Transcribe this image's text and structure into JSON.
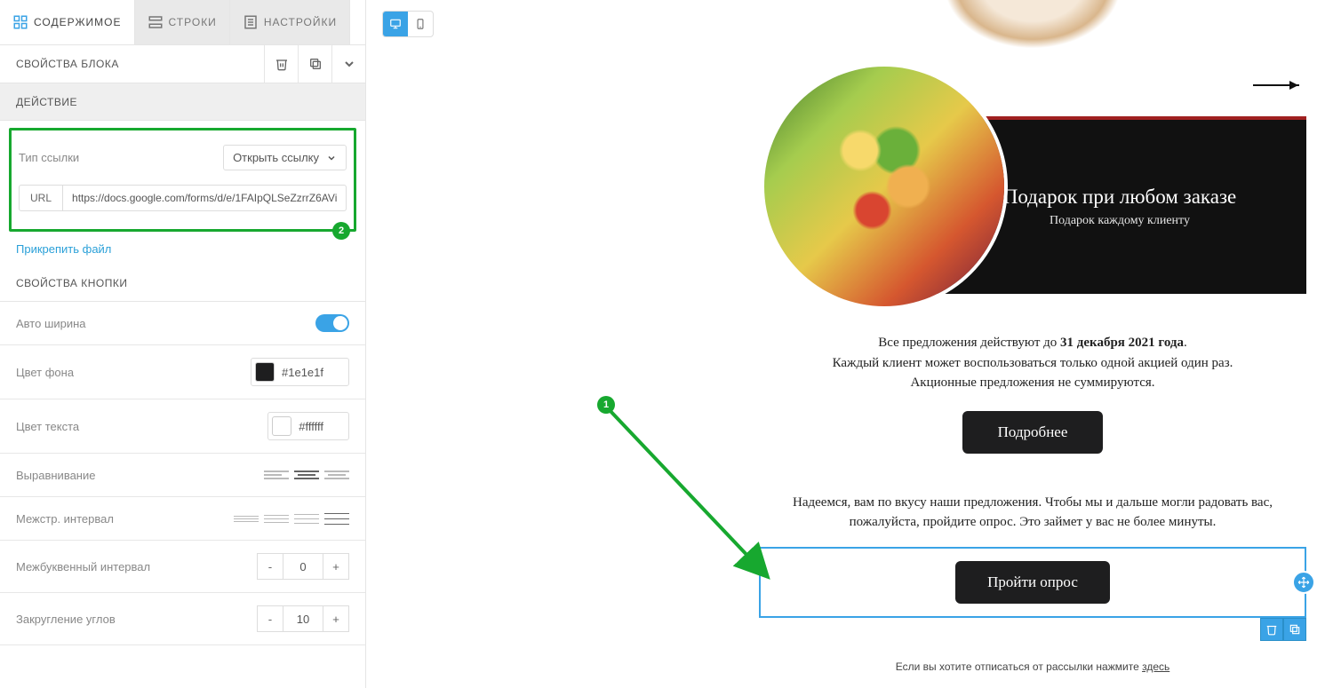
{
  "tabs": {
    "content": "СОДЕРЖИМОЕ",
    "rows": "СТРОКИ",
    "settings": "НАСТРОЙКИ"
  },
  "block": {
    "title": "СВОЙСТВА БЛОКА"
  },
  "action": {
    "title": "ДЕЙСТВИЕ",
    "link_type_label": "Тип ссылки",
    "link_type_value": "Открыть ссылку",
    "url_label": "URL",
    "url_value": "https://docs.google.com/forms/d/e/1FAIpQLSeZzrrZ6AVi",
    "attach": "Прикрепить файл"
  },
  "button_props": {
    "title": "СВОЙСТВА КНОПКИ",
    "auto_width": "Авто ширина",
    "bg_color_label": "Цвет фона",
    "bg_color_value": "#1e1e1f",
    "text_color_label": "Цвет текста",
    "text_color_value": "#ffffff",
    "align_label": "Выравнивание",
    "line_spacing_label": "Межстр. интервал",
    "letter_spacing_label": "Межбуквенный интервал",
    "letter_spacing_value": "0",
    "border_radius_label": "Закругление углов",
    "border_radius_value": "10"
  },
  "preview": {
    "promo_title": "Подарок при любом заказе",
    "promo_sub": "Подарок каждому клиенту",
    "info_line1_a": "Все предложения действуют до ",
    "info_line1_b": "31 декабря 2021 года",
    "info_line1_c": ".",
    "info_line2": "Каждый клиент может воспользоваться только одной акцией один раз.",
    "info_line3": "Акционные предложения не суммируются.",
    "more_btn": "Подробнее",
    "hope": "Надеемся, вам по вкусу наши предложения. Чтобы мы и дальше могли радовать вас, пожалуйста, пройдите опрос. Это займет у вас не более минуты.",
    "survey_btn": "Пройти опрос",
    "unsub_a": "Если вы хотите отписаться от рассылки нажмите ",
    "unsub_link": "здесь"
  },
  "anno": {
    "n1": "1",
    "n2": "2"
  }
}
